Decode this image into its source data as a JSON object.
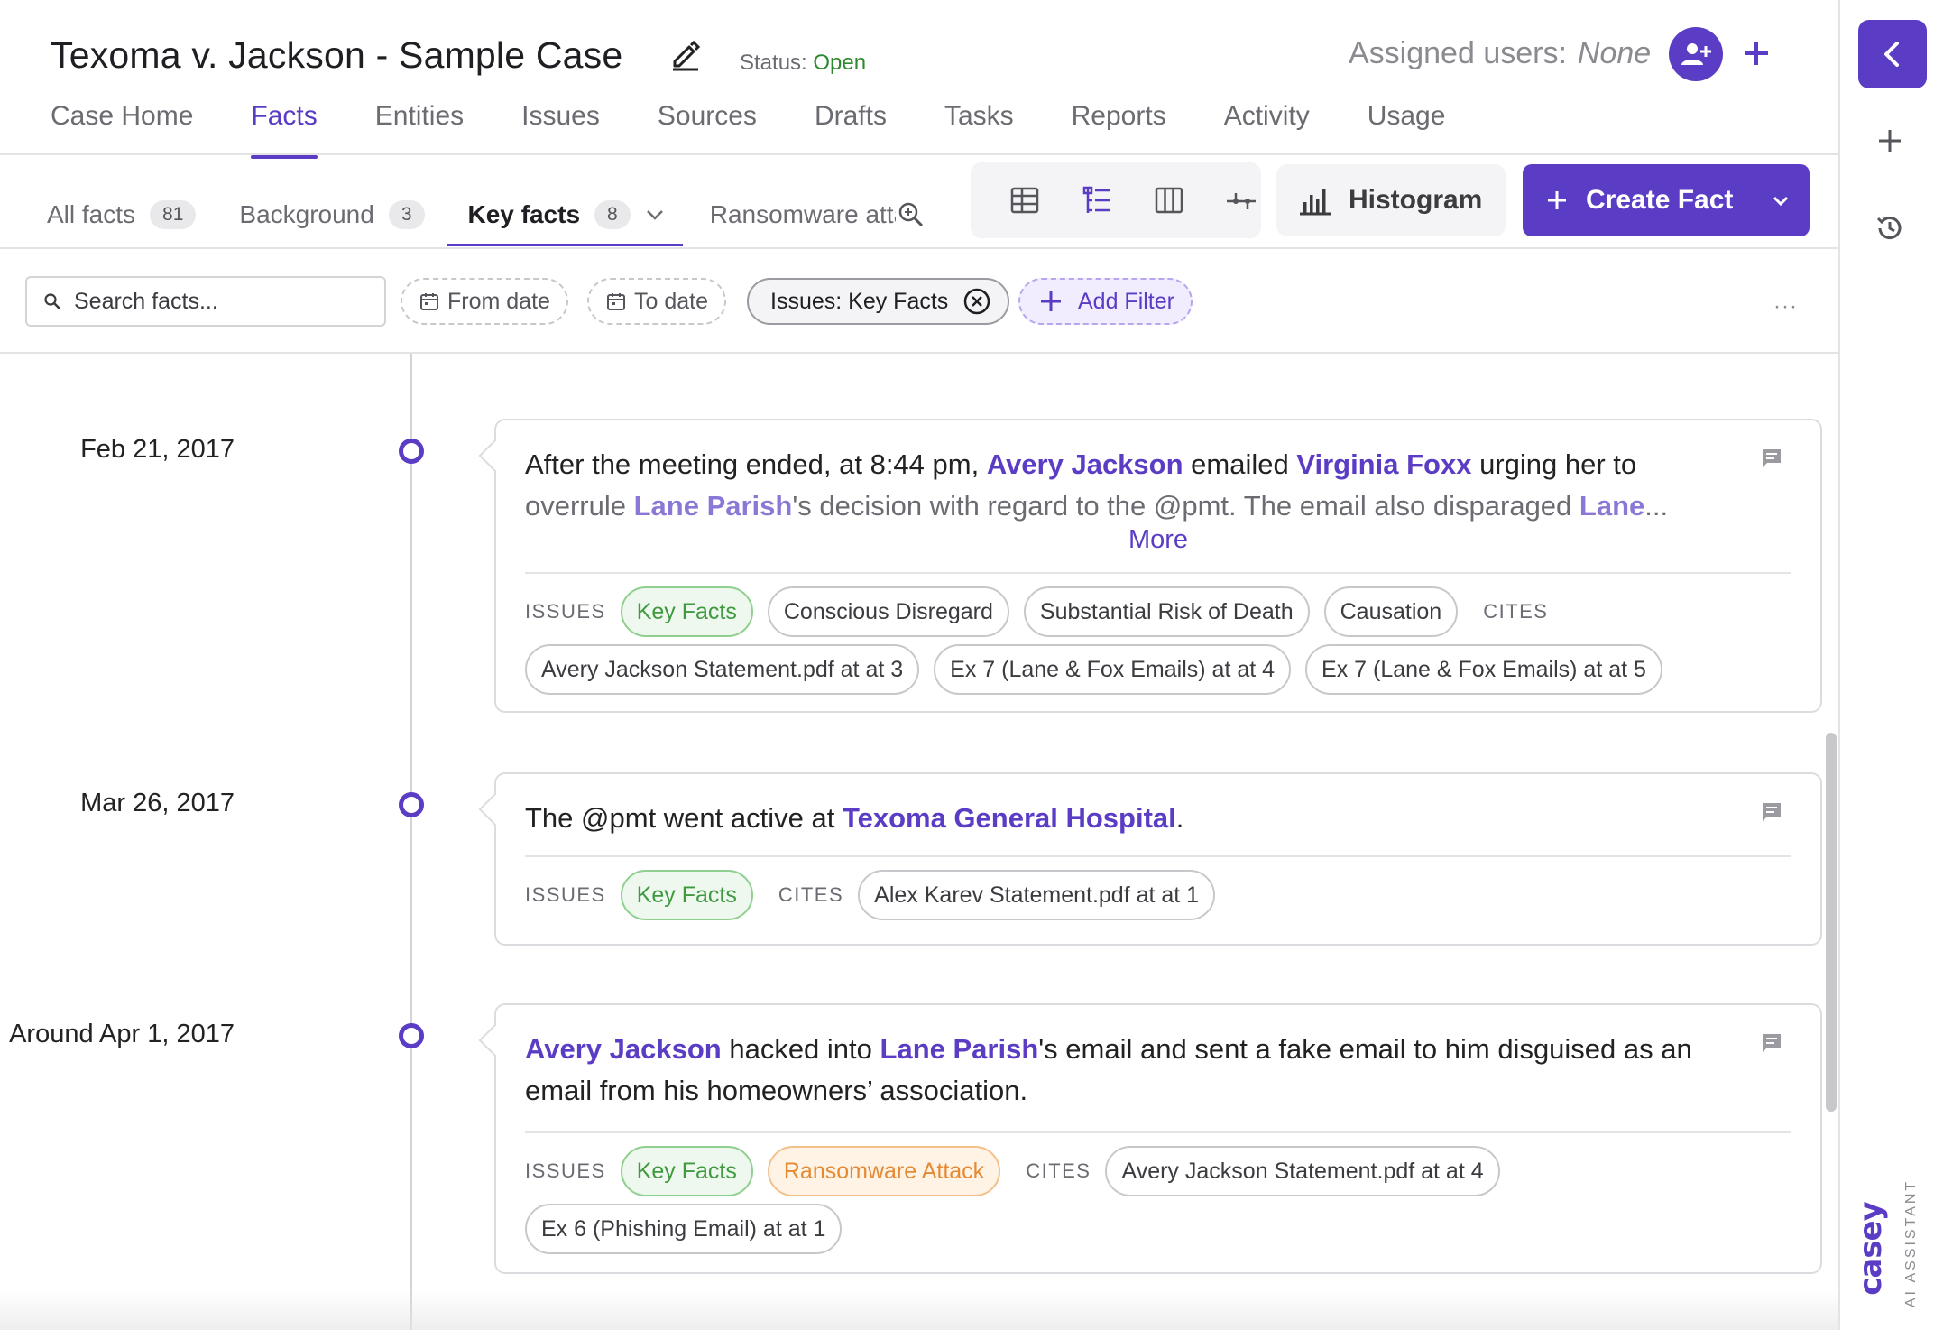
{
  "header": {
    "case_title": "Texoma v. Jackson - Sample Case",
    "status_label": "Status:",
    "status_value": "Open",
    "assigned_label": "Assigned users:",
    "assigned_value": "None"
  },
  "tabs": [
    {
      "label": "Case Home",
      "active": false
    },
    {
      "label": "Facts",
      "active": true
    },
    {
      "label": "Entities",
      "active": false
    },
    {
      "label": "Issues",
      "active": false
    },
    {
      "label": "Sources",
      "active": false
    },
    {
      "label": "Drafts",
      "active": false
    },
    {
      "label": "Tasks",
      "active": false
    },
    {
      "label": "Reports",
      "active": false
    },
    {
      "label": "Activity",
      "active": false
    },
    {
      "label": "Usage",
      "active": false
    }
  ],
  "subtabs": {
    "all": {
      "label": "All facts",
      "count": "81"
    },
    "background": {
      "label": "Background",
      "count": "3"
    },
    "key": {
      "label": "Key facts",
      "count": "8"
    },
    "ransomware": {
      "label": "Ransomware attack"
    }
  },
  "toolbar": {
    "histogram_label": "Histogram",
    "create_label": "Create Fact"
  },
  "filters": {
    "search_placeholder": "Search facts...",
    "from_date": "From date",
    "to_date": "To date",
    "active_filter": "Issues: Key Facts",
    "add_filter": "Add Filter",
    "more": "···"
  },
  "labels": {
    "issues": "ISSUES",
    "cites": "CITES",
    "more": "More"
  },
  "facts": [
    {
      "date": "Feb 21, 2017",
      "text": {
        "p1": "After the meeting ended, at 8:44 pm, ",
        "e1": "Avery Jackson",
        "p2": " emailed ",
        "e2": "Virginia Foxx",
        "p3": " urging her to",
        "p4": "overrule ",
        "e3": "Lane Parish",
        "p5": "'s decision with regard to the @pmt. The email also disparaged ",
        "e4": "Lane",
        "p6": "..."
      },
      "issues": [
        "Key Facts",
        "Conscious Disregard",
        "Substantial Risk of Death",
        "Causation"
      ],
      "cites": [
        "Avery Jackson Statement.pdf at at 3",
        "Ex 7 (Lane & Fox Emails) at at 4",
        "Ex 7 (Lane & Fox Emails) at at 5"
      ]
    },
    {
      "date": "Mar 26, 2017",
      "text": {
        "p1": "The @pmt went active at ",
        "e1": "Texoma General Hospital",
        "p2": "."
      },
      "issues": [
        "Key Facts"
      ],
      "cites": [
        "Alex Karev Statement.pdf at at 1"
      ]
    },
    {
      "date": "Around Apr 1, 2017",
      "text": {
        "e1": "Avery Jackson",
        "p1": " hacked into ",
        "e2": "Lane Parish",
        "p2": "'s email and sent a fake email to him disguised as an",
        "p3": "email from his homeowners’ association."
      },
      "issues": [
        "Key Facts",
        "Ransomware Attack"
      ],
      "cites": [
        "Avery Jackson Statement.pdf at at 4",
        "Ex 6 (Phishing Email) at at 1"
      ]
    }
  ],
  "brand": {
    "name": "casey",
    "tagline": "AI ASSISTANT"
  },
  "colors": {
    "accent": "#5b3cc4",
    "status_open": "#2f8a2f",
    "issue_key_facts": "#3f9a3f",
    "issue_ransomware": "#e58a32"
  }
}
